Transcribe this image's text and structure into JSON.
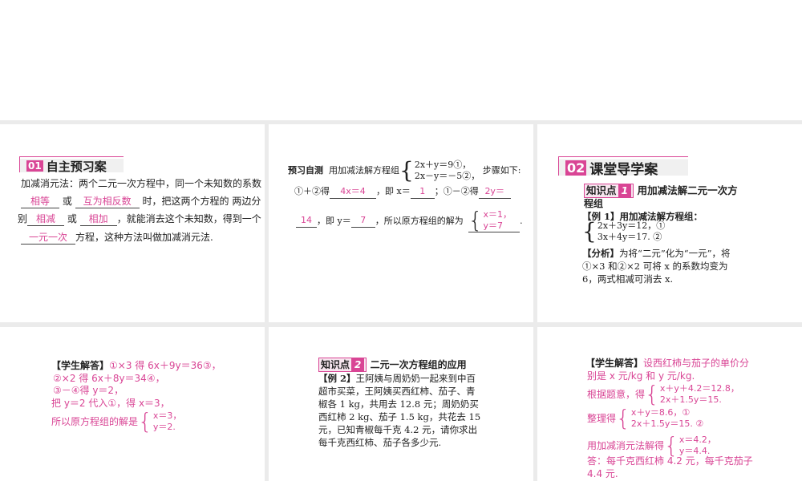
{
  "p1": {
    "sec_num": "01",
    "sec_title": "自主预习案",
    "l1": "加减消元法：两个二元一次方程中，同一个未知数的系数",
    "a1": "相等",
    "or1": "或",
    "a2": "互为相反数",
    "t2": "时，把这两个方程的 两边分",
    "t3a": "别",
    "a3": "相减",
    "or2": "或",
    "a4": "相加",
    "t3b": "，就能消去这个未知数，得到一个",
    "a5": "一元一次",
    "t4": "方程，这种方法叫做加减消元法."
  },
  "p2": {
    "label": "预习自测",
    "intro": "用加减法解方程组",
    "eq1": "2x＋y＝9①，",
    "eq2": "2x－y＝－5②，",
    "after": "步骤如下:",
    "s1": "①＋②得",
    "a1": "4x＝4",
    "s2": "，即 x＝",
    "a2": "1",
    "s3": "；①－②得",
    "a3": "2y＝",
    "a3b": "14",
    "s4": "，即 y＝",
    "a4": "7",
    "s5": "，所以原方程组的解为",
    "sol1": "x＝1，",
    "sol2": "y＝7",
    "end": "."
  },
  "p3": {
    "sec_num": "02",
    "sec_title": "课堂导学案",
    "kp_label": "知识点",
    "kp_num": "1",
    "kp_title": "用加减法解二元一次方",
    "kp_title2": "程组",
    "ex_label": "【例 1】",
    "ex_text": "用加减法解方程组：",
    "eq1": "2x＋3y＝12，①",
    "eq2": "3x＋4y＝17. ②",
    "an_label": "【分析】",
    "an1": "为将“二元”化为“一元”，将",
    "an2": "①×3 和②×2 可将 x 的系数均变为",
    "an3": "6，两式相减可消去 x."
  },
  "p4": {
    "label": "【学生解答】",
    "l1": "①×3 得 6x＋9y＝36③，",
    "l2": "②×2 得 6x＋8y＝34④，",
    "l3": "③－④得 y＝2，",
    "l4": "把 y＝2 代入①，得 x＝3，",
    "l5": "所以原方程组的解是",
    "sol1": "x＝3，",
    "sol2": "y＝2."
  },
  "p5": {
    "kp_label": "知识点",
    "kp_num": "2",
    "kp_title": "二元一次方程组的应用",
    "ex_label": "【例 2】",
    "lines": [
      "王阿姨与周奶奶一起来到中百",
      "超市买菜，王阿姨买西红柿、茄子、青",
      "椒各 1 kg，共用去 12.8 元；周奶奶买",
      "西红柿 2 kg、茄子 1.5 kg，共花去 15",
      "元，已知青椒每千克 4.2 元，请你求出",
      "每千克西红柿、茄子各多少元."
    ]
  },
  "p6": {
    "label": "【学生解答】",
    "l1": "设西红柿与茄子的单价分",
    "l2": "别是 x 元/kg 和 y 元/kg.",
    "l3": "根据题意，得",
    "e1a": "x＋y＋4.2＝12.8，",
    "e1b": "2x＋1.5y＝15.",
    "l4": "整理得",
    "e2a": "x＋y＝8.6，①",
    "e2b": "2x＋1.5y＝15. ②",
    "l5": "用加减消元法解得",
    "e3a": "x＝4.2，",
    "e3b": "y＝4.4.",
    "l6": "答：每千克西红柿 4.2 元，每千克茄子",
    "l7": "4.4 元."
  }
}
